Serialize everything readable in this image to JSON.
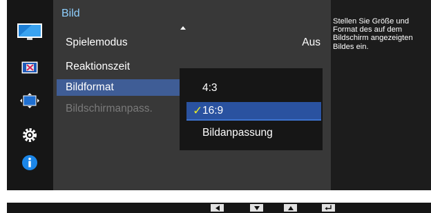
{
  "menu": {
    "title": "Bild",
    "items": [
      {
        "label": "Spielemodus",
        "value": "Aus"
      },
      {
        "label": "Reaktionszeit",
        "value": ""
      },
      {
        "label": "Bildformat",
        "value": ""
      },
      {
        "label": "Bildschirmanpass.",
        "value": ""
      }
    ]
  },
  "sidebar": {
    "icons": [
      "picture-icon",
      "color-icon",
      "size-position-icon",
      "settings-gear-icon",
      "information-icon"
    ]
  },
  "submenu": {
    "options": [
      "4:3",
      "16:9",
      "Bildanpassung"
    ],
    "selected": "16:9"
  },
  "help": {
    "lines": [
      "Stellen Sie Größe und",
      "Format des auf dem",
      "Bildschirm angezeigten",
      "Bildes ein."
    ]
  },
  "bottom_bar": {
    "keys": [
      "left-arrow-icon",
      "down-arrow-icon",
      "up-arrow-icon",
      "enter-icon"
    ]
  },
  "colors": {
    "accent_title": "#8fd0ff",
    "highlight": "#3f5d96",
    "selection": "#2a52a0",
    "checkmark": "#e4ea2a"
  }
}
